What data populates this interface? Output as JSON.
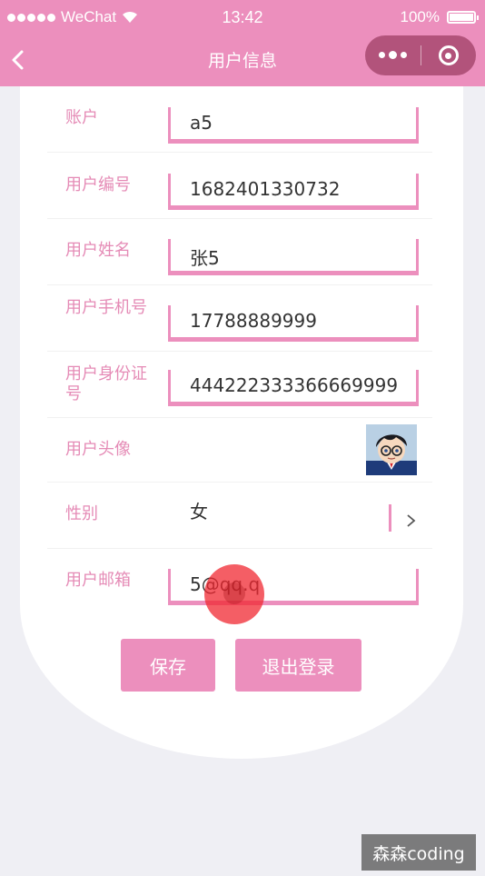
{
  "status_bar": {
    "carrier": "WeChat",
    "time": "13:42",
    "battery": "100%"
  },
  "nav": {
    "title": "用户信息"
  },
  "form": {
    "fields": [
      {
        "label": "账户",
        "value": "a5"
      },
      {
        "label": "用户编号",
        "value": "1682401330732"
      },
      {
        "label": "用户姓名",
        "value": "张5"
      },
      {
        "label": "用户手机号",
        "value": "17788889999"
      },
      {
        "label": "用户身份证号",
        "value": "444222333366669999"
      }
    ],
    "avatar": {
      "label": "用户头像"
    },
    "gender": {
      "label": "性别",
      "value": "女"
    },
    "email": {
      "label": "用户邮箱",
      "value": "5@qq.q"
    }
  },
  "buttons": {
    "save": "保存",
    "logout": "退出登录"
  },
  "watermark": "森森coding",
  "colors": {
    "accent": "#ec8fbd",
    "label": "#e58bb6",
    "capsule": "#b2537b"
  }
}
